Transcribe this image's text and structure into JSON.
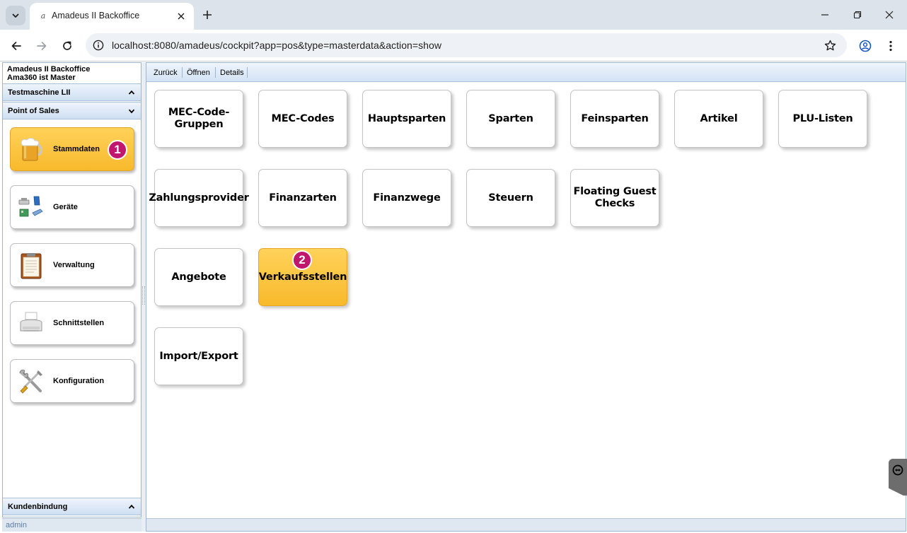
{
  "browser": {
    "tab_title": "Amadeus II Backoffice",
    "url": "localhost:8080/amadeus/cockpit?app=pos&type=masterdata&action=show"
  },
  "sidebar": {
    "app_title_line1": "Amadeus II Backoffice",
    "app_title_line2": "Ama360 ist Master",
    "sections": {
      "testmaschine": "Testmaschine LII",
      "pos": "Point of Sales",
      "kundenbindung": "Kundenbindung"
    },
    "items": [
      {
        "label": "Stammdaten",
        "icon": "beer-mug-icon",
        "active": true
      },
      {
        "label": "Geräte",
        "icon": "devices-icon",
        "active": false
      },
      {
        "label": "Verwaltung",
        "icon": "clipboard-icon",
        "active": false
      },
      {
        "label": "Schnittstellen",
        "icon": "printer-icon",
        "active": false
      },
      {
        "label": "Konfiguration",
        "icon": "tools-icon",
        "active": false
      }
    ],
    "badge": "1",
    "status_user": "admin"
  },
  "toolbar": {
    "back": "Zurück",
    "open": "Öffnen",
    "details": "Details"
  },
  "tiles": [
    {
      "label": "MEC-Code-Gruppen",
      "active": false
    },
    {
      "label": "MEC-Codes",
      "active": false
    },
    {
      "label": "Hauptsparten",
      "active": false
    },
    {
      "label": "Sparten",
      "active": false
    },
    {
      "label": "Feinsparten",
      "active": false
    },
    {
      "label": "Artikel",
      "active": false
    },
    {
      "label": "PLU-Listen",
      "active": false
    },
    {
      "label": "Zahlungsprovider",
      "active": false
    },
    {
      "label": "Finanzarten",
      "active": false
    },
    {
      "label": "Finanzwege",
      "active": false
    },
    {
      "label": "Steuern",
      "active": false
    },
    {
      "label": "Floating Guest Checks",
      "active": false
    },
    {
      "label": "Angebote",
      "active": false
    },
    {
      "label": "Verkaufsstellen",
      "active": true
    },
    {
      "label": "Import/Export",
      "active": false
    }
  ],
  "tile_badge": "2",
  "colors": {
    "active_tile": "#f8b92c",
    "badge": "#c0166d",
    "header_blue": "#d3e3f5"
  }
}
